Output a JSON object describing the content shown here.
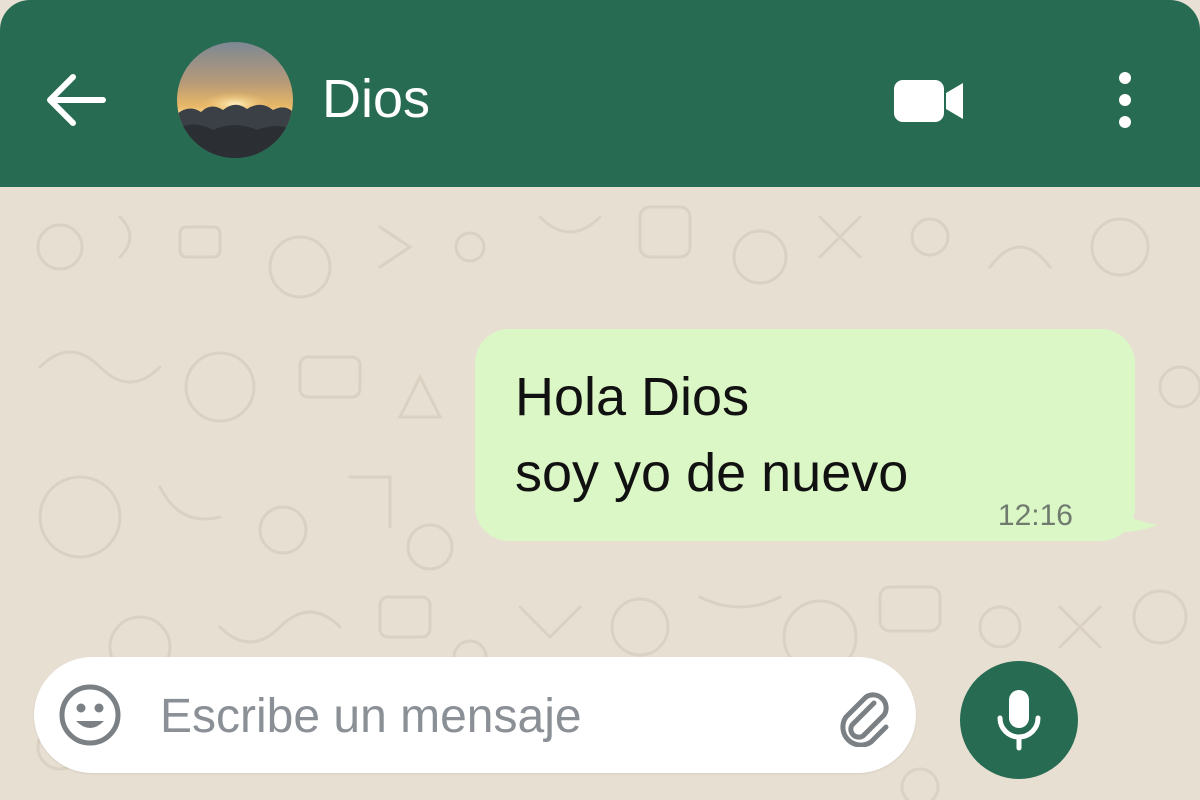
{
  "header": {
    "contact_name": "Dios",
    "icons": {
      "back": "arrow-left-icon",
      "avatar": "sunset-clouds-avatar",
      "video": "video-camera-icon",
      "menu": "vertical-dots-icon"
    }
  },
  "messages": [
    {
      "direction": "outgoing",
      "lines": [
        "Hola Dios",
        "soy yo de nuevo"
      ],
      "time": "12:16"
    }
  ],
  "composer": {
    "placeholder": "Escribe un mensaje",
    "value": "",
    "icons": {
      "emoji": "smiley-icon",
      "attach": "paperclip-icon",
      "send": "microphone-icon"
    }
  },
  "colors": {
    "header_bg": "#276b52",
    "chat_bg": "#e7dfd2",
    "outgoing_bubble": "#dcf7c6",
    "mic_button": "#276b52"
  }
}
